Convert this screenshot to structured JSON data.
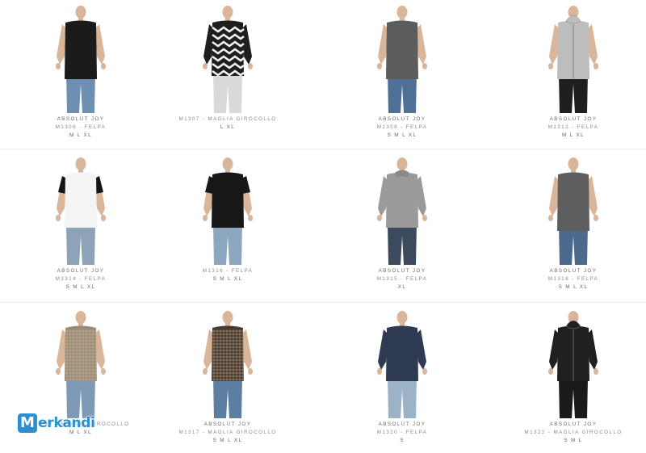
{
  "products": [
    {
      "brand": "ABSOLUT JOY",
      "model": "M1306 - FELPA",
      "sizes": "M L XL",
      "top_color": "#1b1b1b",
      "pants_color": "#6f8fb2",
      "top_style": "sleeveless"
    },
    {
      "brand": "",
      "model": "M1307 - MAGLIA GIROCOLLO",
      "sizes": "L XL",
      "top_color": "#1e1e1e",
      "pants_color": "#d9d9d9",
      "top_style": "chevron"
    },
    {
      "brand": "ABSOLUT JOY",
      "model": "M1308 - FELPA",
      "sizes": "S M L XL",
      "top_color": "#5c5c5c",
      "pants_color": "#4e6f96",
      "top_style": "sleeveless"
    },
    {
      "brand": "ABSOLUT JOY",
      "model": "M1312 - FELPA",
      "sizes": "M L XL",
      "top_color": "#bdbdbd",
      "pants_color": "#1f1f1f",
      "top_style": "hoodie-vest"
    },
    {
      "brand": "ABSOLUT JOY",
      "model": "M1314 - FELPA",
      "sizes": "S M L XL",
      "top_color": "#f4f4f4",
      "pants_color": "#8ea3b8",
      "top_style": "raglan"
    },
    {
      "brand": "",
      "model": "M1316 - FELPA",
      "sizes": "S M L XL",
      "top_color": "#171717",
      "pants_color": "#8ea7c0",
      "top_style": "tee"
    },
    {
      "brand": "ABSOLUT JOY",
      "model": "M1315 - FELPA",
      "sizes": "XL",
      "top_color": "#9a9a9a",
      "pants_color": "#3b4a5c",
      "top_style": "longsleeve"
    },
    {
      "brand": "ABSOLUT JOY",
      "model": "M1318 - FELPA",
      "sizes": "S M L XL",
      "top_color": "#5e5e5e",
      "pants_color": "#4c6a8e",
      "top_style": "sleeveless"
    },
    {
      "brand": "",
      "model": "M1319 - MAGLIA GIROCOLLO",
      "sizes": "M L XL",
      "top_color": "#9b8a74",
      "pants_color": "#7f9ab6",
      "top_style": "mesh"
    },
    {
      "brand": "ABSOLUT JOY",
      "model": "M1317 - MAGLIA GIROCOLLO",
      "sizes": "S M L XL",
      "top_color": "#4a3a2e",
      "pants_color": "#5d7ea3",
      "top_style": "mesh"
    },
    {
      "brand": "ABSOLUT JOY",
      "model": "M1320 - FELPA",
      "sizes": "S",
      "top_color": "#2f3b52",
      "pants_color": "#9cb2c7",
      "top_style": "longsleeve"
    },
    {
      "brand": "ABSOLUT JOY",
      "model": "M1322 - MAGLIA GIROCOLLO",
      "sizes": "S M L",
      "top_color": "#202020",
      "pants_color": "#1a1a1a",
      "top_style": "hoodie"
    }
  ],
  "watermark": {
    "badge": "M",
    "text": "erkandi",
    "color": "#2d8fcf"
  }
}
